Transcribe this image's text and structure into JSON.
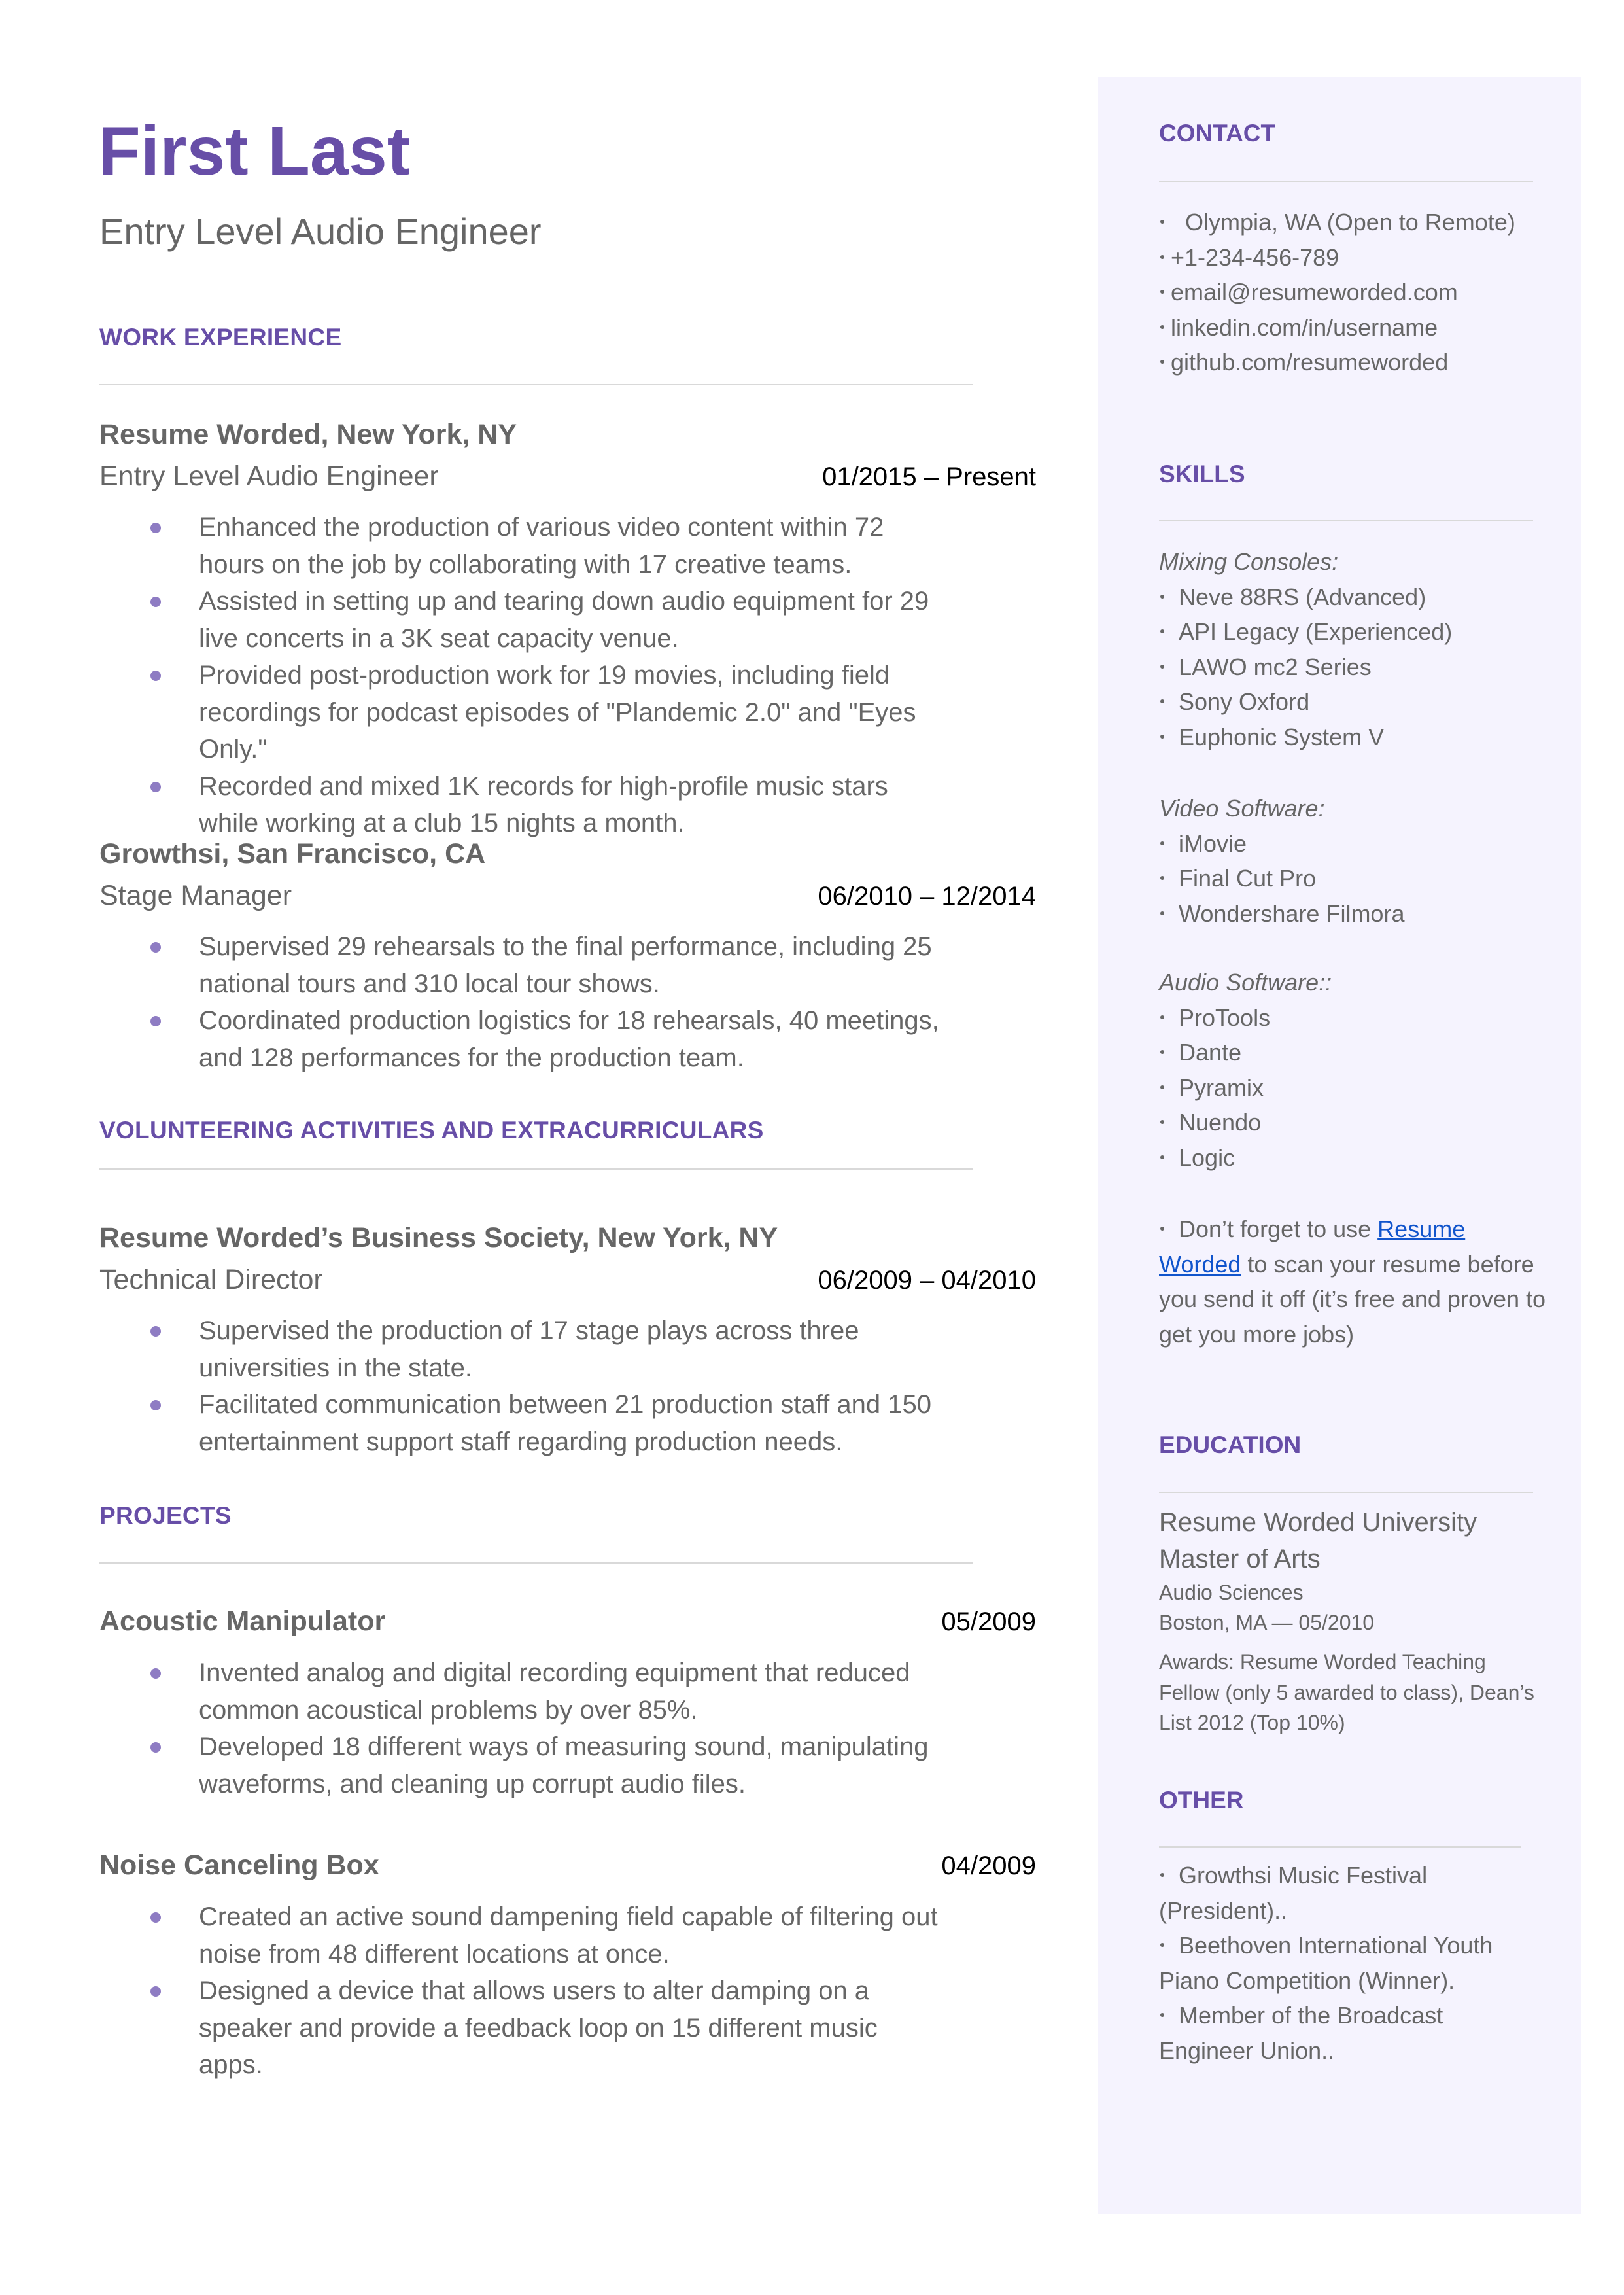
{
  "header": {
    "name": "First Last",
    "title": "Entry Level Audio Engineer"
  },
  "colors": {
    "accent": "#674ea7",
    "bullet": "#8e7cc3",
    "sidebar_bg": "#f5f3fe",
    "text": "#666666",
    "date": "#000000",
    "link": "#1155cc",
    "rule": "#d9d9d9"
  },
  "work_experience": {
    "heading": "WORK EXPERIENCE",
    "entries": [
      {
        "org": "Resume Worded, New York, NY",
        "role": "Entry Level Audio Engineer",
        "dates": "01/2015 – Present",
        "bullets": [
          "Enhanced the production of various video content within 72 hours on the job by collaborating with 17 creative teams.",
          "Assisted in setting up and tearing down audio equipment for 29 live concerts in a 3K seat capacity venue.",
          "Provided post-production work for 19 movies, including field recordings for podcast episodes of \"Plandemic 2.0\" and \"Eyes Only.\"",
          "Recorded and mixed 1K records for high-profile music stars while working at a club 15 nights a month."
        ]
      },
      {
        "org": "Growthsi, San Francisco, CA",
        "role": "Stage Manager",
        "dates": "06/2010 – 12/2014",
        "bullets": [
          "Supervised 29 rehearsals to the final performance, including 25 national tours and 310 local tour shows.",
          "Coordinated production logistics for 18 rehearsals, 40 meetings, and 128 performances for the production team."
        ]
      }
    ]
  },
  "volunteering": {
    "heading": "VOLUNTEERING ACTIVITIES AND EXTRACURRICULARS",
    "entries": [
      {
        "org": "Resume Worded’s Business Society, New York, NY",
        "role": "Technical Director",
        "dates": "06/2009 – 04/2010",
        "bullets": [
          "Supervised the production of 17 stage plays across three universities in the state.",
          " Facilitated communication between 21 production staff and 150 entertainment support staff regarding production needs."
        ]
      }
    ]
  },
  "projects": {
    "heading": "PROJECTS",
    "entries": [
      {
        "name": "Acoustic Manipulator",
        "date": "05/2009",
        "bullets": [
          "Invented analog and digital recording equipment that reduced common acoustical problems by over 85%.",
          "Developed 18 different ways of measuring sound, manipulating waveforms, and cleaning up corrupt audio files."
        ]
      },
      {
        "name": "Noise Canceling Box",
        "date": "04/2009",
        "bullets": [
          "Created an active sound dampening field capable of filtering out noise from 48 different locations at once.",
          "Designed a device that allows users to alter damping on a speaker and provide a feedback loop on 15 different music apps."
        ]
      }
    ]
  },
  "sidebar": {
    "contact": {
      "heading": "CONTACT",
      "items": [
        " Olympia, WA (Open to Remote)",
        "+1-234-456-789",
        "email@resumeworded.com",
        "linkedin.com/in/username",
        "github.com/resumeworded"
      ]
    },
    "skills": {
      "heading": "SKILLS",
      "groups": [
        {
          "label": "Mixing Consoles:",
          "items": [
            "Neve 88RS (Advanced)",
            "API Legacy (Experienced)",
            "LAWO mc2 Series",
            "Sony Oxford",
            "Euphonic System V"
          ]
        },
        {
          "label": "Video Software:",
          "items": [
            "iMovie",
            "Final Cut Pro",
            "Wondershare Filmora"
          ]
        },
        {
          "label": "Audio Software::",
          "items": [
            "ProTools",
            "Dante",
            "Pyramix",
            "Nuendo",
            "Logic"
          ]
        }
      ],
      "tip": {
        "before": "Don’t forget to use ",
        "link": "Resume Worded",
        "after": " to scan your resume before you send it off (it’s free and proven to get you more jobs)"
      }
    },
    "education": {
      "heading": "EDUCATION",
      "school": "Resume Worded University",
      "degree": "Master of Arts",
      "field": "Audio Sciences",
      "location_date": "Boston, MA — 05/2010",
      "awards": "Awards: Resume Worded Teaching Fellow (only 5 awarded to class), Dean’s List 2012 (Top 10%)"
    },
    "other": {
      "heading": "OTHER",
      "items": [
        "Growthsi Music Festival (President)..",
        "Beethoven International Youth Piano Competition (Winner).",
        "Member of the Broadcast Engineer Union.."
      ]
    }
  }
}
